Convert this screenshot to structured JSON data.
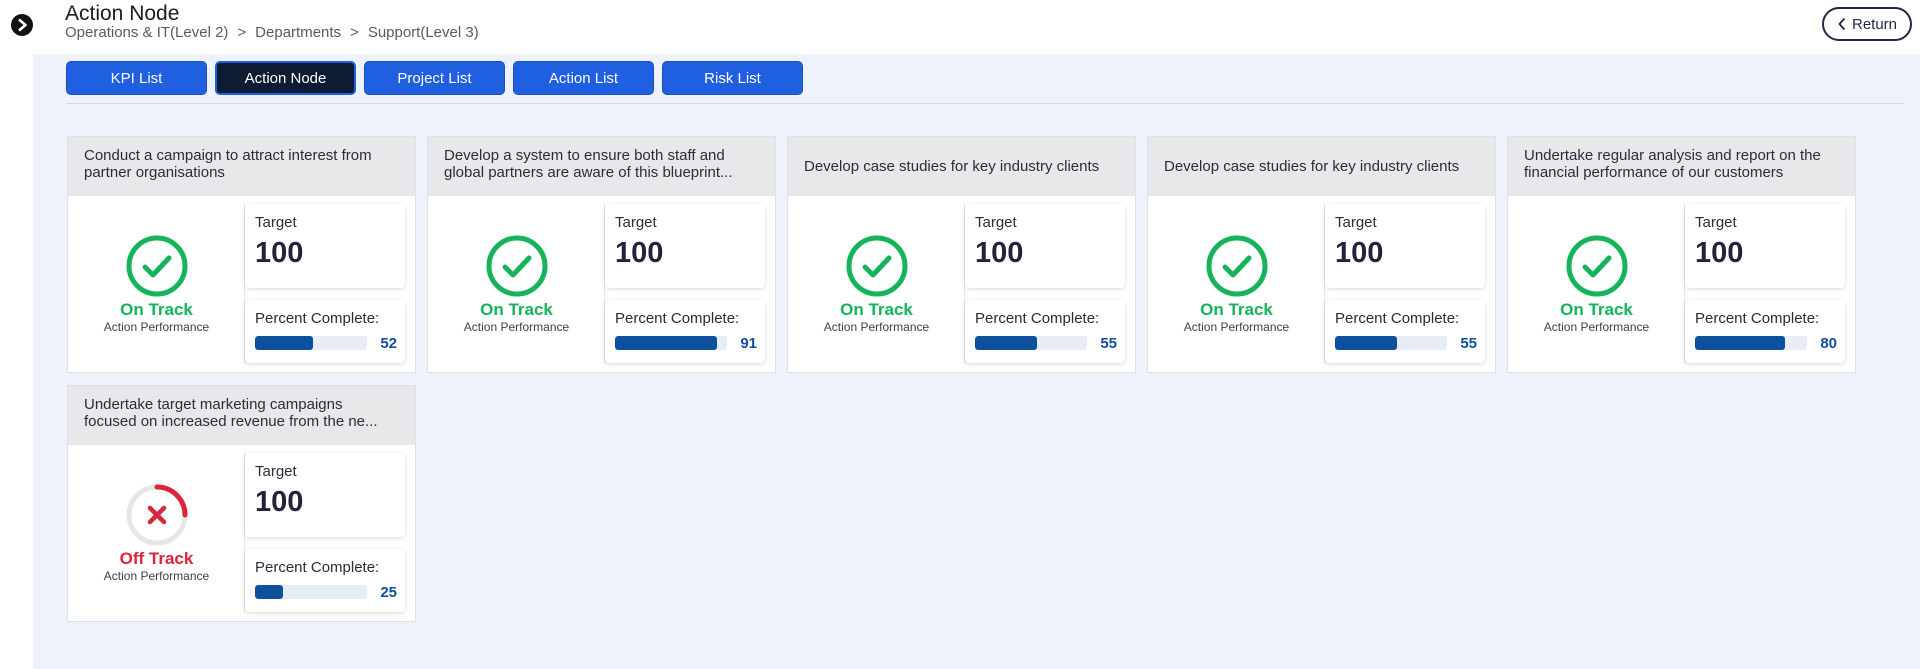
{
  "header": {
    "title": "Action Node",
    "breadcrumb": [
      "Operations & IT(Level 2)",
      "Departments",
      "Support(Level 3)"
    ],
    "return_label": "Return"
  },
  "tabs": [
    {
      "label": "KPI List",
      "active": false
    },
    {
      "label": "Action Node",
      "active": true
    },
    {
      "label": "Project List",
      "active": false
    },
    {
      "label": "Action List",
      "active": false
    },
    {
      "label": "Risk List",
      "active": false
    }
  ],
  "colors": {
    "accent": "#1f5fe0",
    "on_track": "#16b35a",
    "off_track": "#d9263a",
    "progress": "#0e4f9e"
  },
  "cards": [
    {
      "title": "Conduct a campaign to attract interest from partner organisations",
      "status": "On Track",
      "status_sub": "Action Performance",
      "target_label": "Target",
      "target": "100",
      "percent_label": "Percent Complete:",
      "percent": 52
    },
    {
      "title": "Develop a system to ensure both staff and global partners are aware of this blueprint...",
      "status": "On Track",
      "status_sub": "Action Performance",
      "target_label": "Target",
      "target": "100",
      "percent_label": "Percent Complete:",
      "percent": 91
    },
    {
      "title": "Develop case studies for key industry clients",
      "status": "On Track",
      "status_sub": "Action Performance",
      "target_label": "Target",
      "target": "100",
      "percent_label": "Percent Complete:",
      "percent": 55
    },
    {
      "title": "Develop case studies for key industry clients",
      "status": "On Track",
      "status_sub": "Action Performance",
      "target_label": "Target",
      "target": "100",
      "percent_label": "Percent Complete:",
      "percent": 55
    },
    {
      "title": "Undertake regular analysis and report on the financial performance of our customers",
      "status": "On Track",
      "status_sub": "Action Performance",
      "target_label": "Target",
      "target": "100",
      "percent_label": "Percent Complete:",
      "percent": 80
    },
    {
      "title": "Undertake target marketing campaigns focused on increased revenue from the ne...",
      "status": "Off Track",
      "status_sub": "Action Performance",
      "target_label": "Target",
      "target": "100",
      "percent_label": "Percent Complete:",
      "percent": 25
    }
  ]
}
